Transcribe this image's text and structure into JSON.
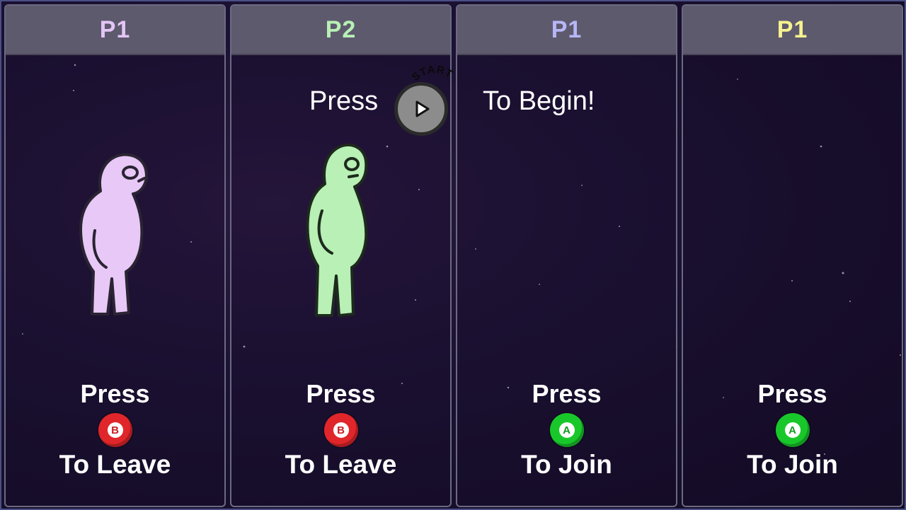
{
  "panels": [
    {
      "player_label": "P1",
      "player_color": "#e3c6f5",
      "character_color": "#e8c8f7",
      "press_label": "Press",
      "button_glyph": "B",
      "button_color": "#e0262a",
      "action_label": "To Leave",
      "joined": true
    },
    {
      "player_label": "P2",
      "player_color": "#b7f0b4",
      "character_color": "#b8f0b6",
      "press_label": "Press",
      "button_glyph": "B",
      "button_color": "#e0262a",
      "action_label": "To Leave",
      "joined": true
    },
    {
      "player_label": "P1",
      "player_color": "#b7b6f5",
      "press_label": "Press",
      "button_glyph": "A",
      "button_color": "#18c82a",
      "action_label": "To Join",
      "joined": false
    },
    {
      "player_label": "P1",
      "player_color": "#f6f28f",
      "press_label": "Press",
      "button_glyph": "A",
      "button_color": "#18c82a",
      "action_label": "To Join",
      "joined": false
    }
  ],
  "start_prompt": {
    "press_text": "Press",
    "button_arc_text": "START",
    "begin_text": "To Begin!",
    "button_icon": "play-triangle-icon"
  }
}
